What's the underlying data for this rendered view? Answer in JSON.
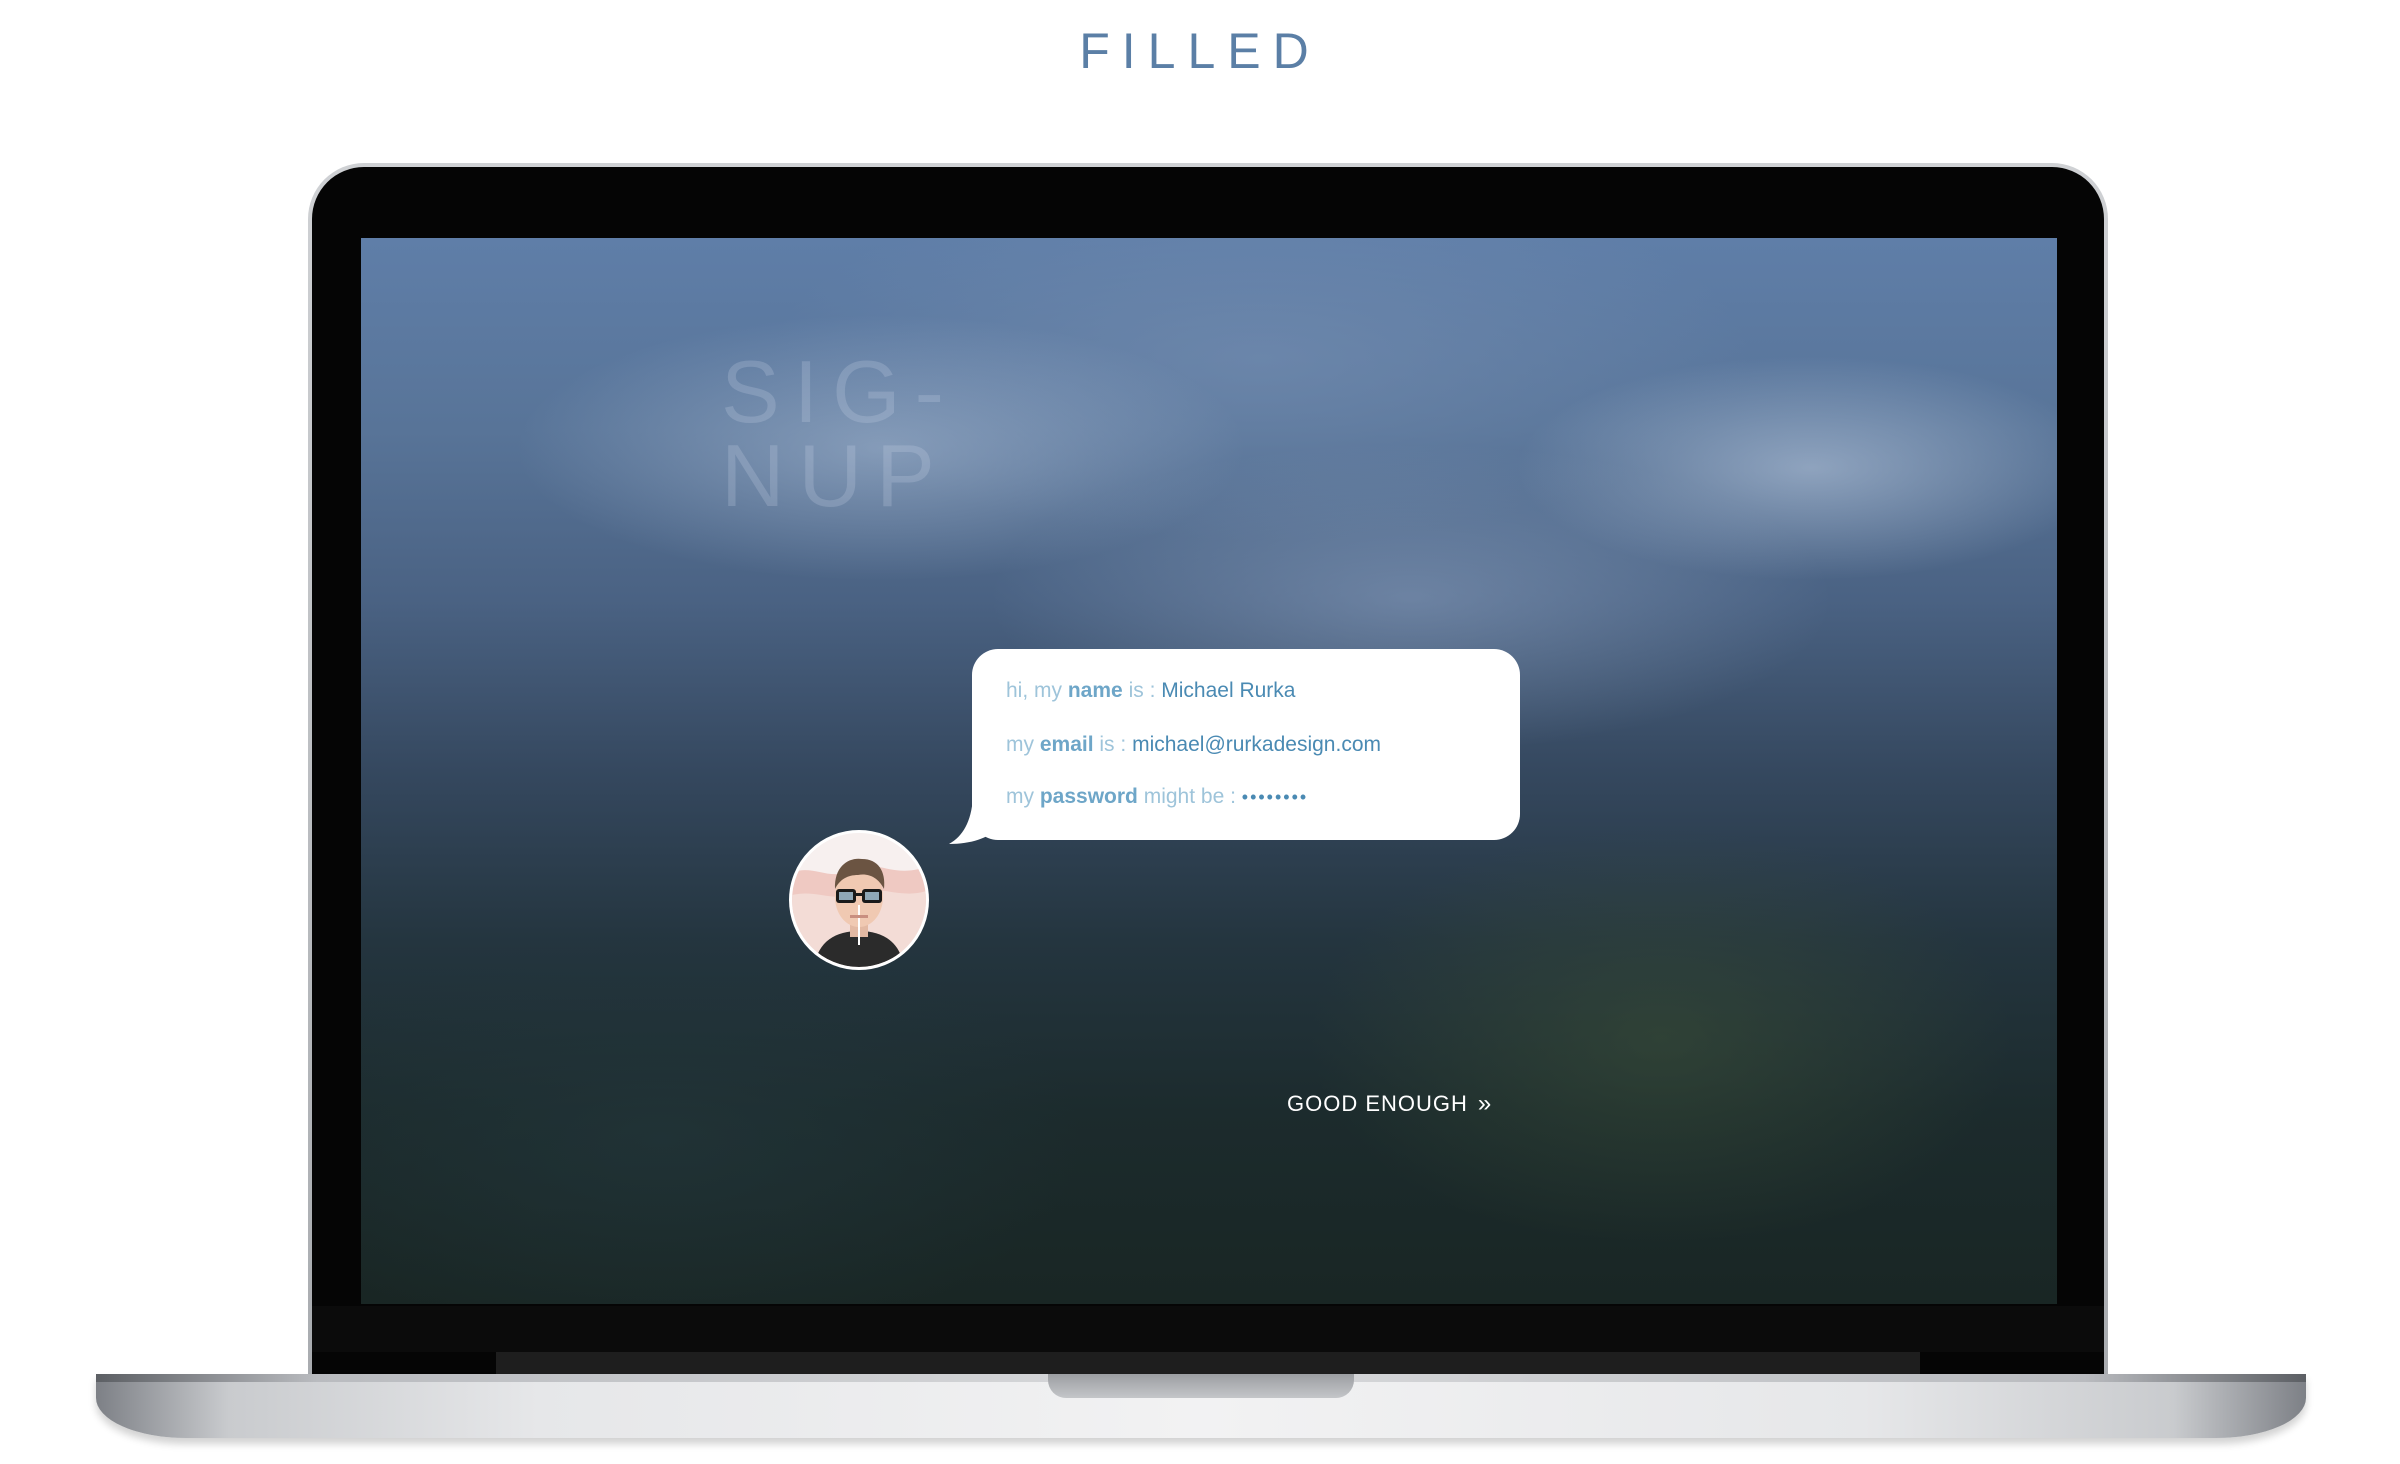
{
  "page_title": "FILLED",
  "screen": {
    "signup_title": "SIG-\nNUP",
    "form": {
      "name_row": {
        "prefix": "hi, my",
        "keyword": "name",
        "connector": "is :",
        "value": "Michael Rurka"
      },
      "email_row": {
        "prefix": "my",
        "keyword": "email",
        "connector": "is :",
        "value": "michael@rurkadesign.com"
      },
      "password_row": {
        "prefix": "my",
        "keyword": "password",
        "connector": "might be :",
        "value": "••••••••"
      }
    },
    "cta_label": "GOOD ENOUGH",
    "cta_icon": "double-chevron-right-icon",
    "avatar_icon": "user-avatar"
  },
  "colors": {
    "heading": "#5b7fa6",
    "form_label": "#9ec4da",
    "form_keyword": "#6ea6c8",
    "form_value": "#4a8ab3"
  }
}
